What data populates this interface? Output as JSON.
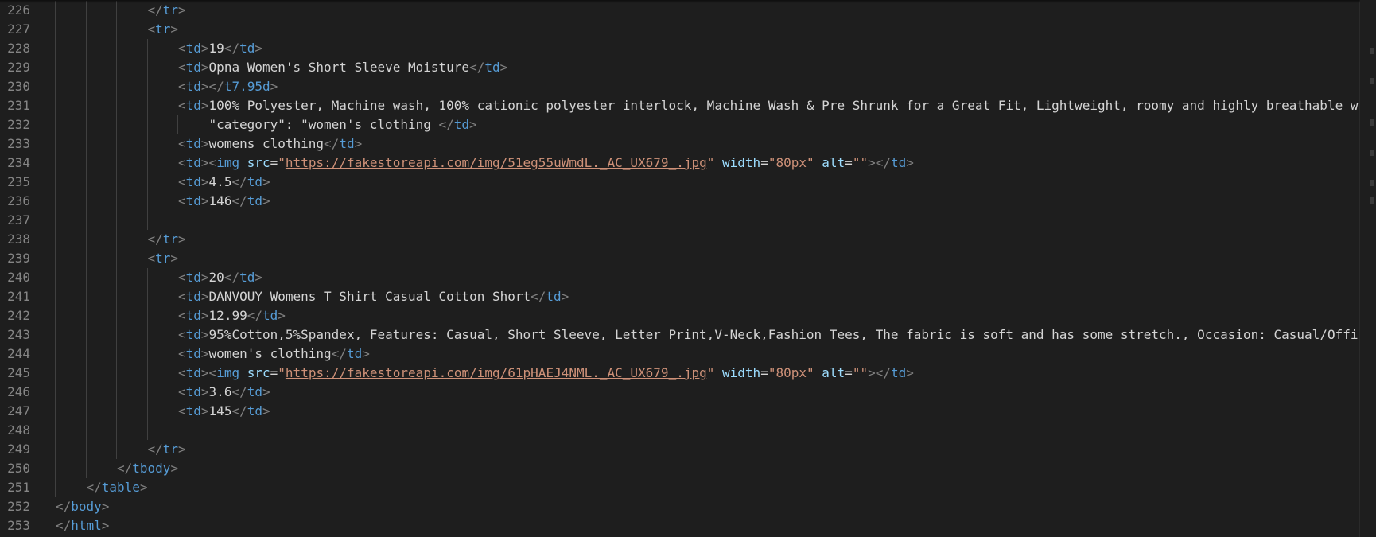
{
  "editor": {
    "colors": {
      "background": "#1e1e1e",
      "line_number": "#858585",
      "tag": "#569cd6",
      "bracket": "#808080",
      "attribute": "#9cdcfe",
      "string": "#ce9178",
      "text": "#d4d4d4"
    },
    "lines": [
      {
        "number": "226",
        "indent": 3,
        "tokens": [
          [
            "b",
            "</"
          ],
          [
            "t",
            "tr"
          ],
          [
            "b",
            ">"
          ]
        ]
      },
      {
        "number": "227",
        "indent": 3,
        "tokens": [
          [
            "b",
            "<"
          ],
          [
            "t",
            "tr"
          ],
          [
            "b",
            ">"
          ]
        ]
      },
      {
        "number": "228",
        "indent": 4,
        "tokens": [
          [
            "b",
            "<"
          ],
          [
            "t",
            "td"
          ],
          [
            "b",
            ">"
          ],
          [
            "x",
            "19"
          ],
          [
            "b",
            "</"
          ],
          [
            "t",
            "td"
          ],
          [
            "b",
            ">"
          ]
        ]
      },
      {
        "number": "229",
        "indent": 4,
        "tokens": [
          [
            "b",
            "<"
          ],
          [
            "t",
            "td"
          ],
          [
            "b",
            ">"
          ],
          [
            "x",
            "Opna Women's Short Sleeve Moisture"
          ],
          [
            "b",
            "</"
          ],
          [
            "t",
            "td"
          ],
          [
            "b",
            ">"
          ]
        ]
      },
      {
        "number": "230",
        "indent": 4,
        "tokens": [
          [
            "b",
            "<"
          ],
          [
            "t",
            "td"
          ],
          [
            "b",
            ">"
          ],
          [
            "b",
            "</"
          ],
          [
            "t",
            "t7.95d"
          ],
          [
            "b",
            ">"
          ]
        ]
      },
      {
        "number": "231",
        "indent": 4,
        "tokens": [
          [
            "b",
            "<"
          ],
          [
            "t",
            "td"
          ],
          [
            "b",
            ">"
          ],
          [
            "x",
            "100% Polyester, Machine wash, 100% cationic polyester interlock, Machine Wash & Pre Shrunk for a Great Fit, Lightweight, roomy and highly breathable w"
          ]
        ]
      },
      {
        "number": "232",
        "indent": 5,
        "tokens": [
          [
            "x",
            "\"category\": \"women's clothing "
          ],
          [
            "b",
            "</"
          ],
          [
            "t",
            "td"
          ],
          [
            "b",
            ">"
          ]
        ]
      },
      {
        "number": "233",
        "indent": 4,
        "tokens": [
          [
            "b",
            "<"
          ],
          [
            "t",
            "td"
          ],
          [
            "b",
            ">"
          ],
          [
            "x",
            "womens clothing"
          ],
          [
            "b",
            "</"
          ],
          [
            "t",
            "td"
          ],
          [
            "b",
            ">"
          ]
        ]
      },
      {
        "number": "234",
        "indent": 4,
        "tokens": [
          [
            "b",
            "<"
          ],
          [
            "t",
            "td"
          ],
          [
            "b",
            ">"
          ],
          [
            "b",
            "<"
          ],
          [
            "t",
            "img"
          ],
          [
            "x",
            " "
          ],
          [
            "a",
            "src"
          ],
          [
            "x",
            "="
          ],
          [
            "s",
            "\""
          ],
          [
            "u",
            "https://fakestoreapi.com/img/51eg55uWmdL._AC_UX679_.jpg"
          ],
          [
            "s",
            "\""
          ],
          [
            "x",
            " "
          ],
          [
            "a",
            "width"
          ],
          [
            "x",
            "="
          ],
          [
            "s",
            "\"80px\""
          ],
          [
            "x",
            " "
          ],
          [
            "a",
            "alt"
          ],
          [
            "x",
            "="
          ],
          [
            "s",
            "\"\""
          ],
          [
            "b",
            ">"
          ],
          [
            "b",
            "</"
          ],
          [
            "t",
            "td"
          ],
          [
            "b",
            ">"
          ]
        ]
      },
      {
        "number": "235",
        "indent": 4,
        "tokens": [
          [
            "b",
            "<"
          ],
          [
            "t",
            "td"
          ],
          [
            "b",
            ">"
          ],
          [
            "x",
            "4.5"
          ],
          [
            "b",
            "</"
          ],
          [
            "t",
            "td"
          ],
          [
            "b",
            ">"
          ]
        ]
      },
      {
        "number": "236",
        "indent": 4,
        "tokens": [
          [
            "b",
            "<"
          ],
          [
            "t",
            "td"
          ],
          [
            "b",
            ">"
          ],
          [
            "x",
            "146"
          ],
          [
            "b",
            "</"
          ],
          [
            "t",
            "td"
          ],
          [
            "b",
            ">"
          ]
        ]
      },
      {
        "number": "237",
        "indent": 4,
        "tokens": []
      },
      {
        "number": "238",
        "indent": 3,
        "tokens": [
          [
            "b",
            "</"
          ],
          [
            "t",
            "tr"
          ],
          [
            "b",
            ">"
          ]
        ]
      },
      {
        "number": "239",
        "indent": 3,
        "tokens": [
          [
            "b",
            "<"
          ],
          [
            "t",
            "tr"
          ],
          [
            "b",
            ">"
          ]
        ]
      },
      {
        "number": "240",
        "indent": 4,
        "tokens": [
          [
            "b",
            "<"
          ],
          [
            "t",
            "td"
          ],
          [
            "b",
            ">"
          ],
          [
            "x",
            "20"
          ],
          [
            "b",
            "</"
          ],
          [
            "t",
            "td"
          ],
          [
            "b",
            ">"
          ]
        ]
      },
      {
        "number": "241",
        "indent": 4,
        "tokens": [
          [
            "b",
            "<"
          ],
          [
            "t",
            "td"
          ],
          [
            "b",
            ">"
          ],
          [
            "x",
            "DANVOUY Womens T Shirt Casual Cotton Short"
          ],
          [
            "b",
            "</"
          ],
          [
            "t",
            "td"
          ],
          [
            "b",
            ">"
          ]
        ]
      },
      {
        "number": "242",
        "indent": 4,
        "tokens": [
          [
            "b",
            "<"
          ],
          [
            "t",
            "td"
          ],
          [
            "b",
            ">"
          ],
          [
            "x",
            "12.99"
          ],
          [
            "b",
            "</"
          ],
          [
            "t",
            "td"
          ],
          [
            "b",
            ">"
          ]
        ]
      },
      {
        "number": "243",
        "indent": 4,
        "tokens": [
          [
            "b",
            "<"
          ],
          [
            "t",
            "td"
          ],
          [
            "b",
            ">"
          ],
          [
            "x",
            "95%Cotton,5%Spandex, Features: Casual, Short Sleeve, Letter Print,V-Neck,Fashion Tees, The fabric is soft and has some stretch., Occasion: Casual/Offic"
          ]
        ]
      },
      {
        "number": "244",
        "indent": 4,
        "tokens": [
          [
            "b",
            "<"
          ],
          [
            "t",
            "td"
          ],
          [
            "b",
            ">"
          ],
          [
            "x",
            "women's clothing"
          ],
          [
            "b",
            "</"
          ],
          [
            "t",
            "td"
          ],
          [
            "b",
            ">"
          ]
        ]
      },
      {
        "number": "245",
        "indent": 4,
        "tokens": [
          [
            "b",
            "<"
          ],
          [
            "t",
            "td"
          ],
          [
            "b",
            ">"
          ],
          [
            "b",
            "<"
          ],
          [
            "t",
            "img"
          ],
          [
            "x",
            " "
          ],
          [
            "a",
            "src"
          ],
          [
            "x",
            "="
          ],
          [
            "s",
            "\""
          ],
          [
            "u",
            "https://fakestoreapi.com/img/61pHAEJ4NML._AC_UX679_.jpg"
          ],
          [
            "s",
            "\""
          ],
          [
            "x",
            " "
          ],
          [
            "a",
            "width"
          ],
          [
            "x",
            "="
          ],
          [
            "s",
            "\"80px\""
          ],
          [
            "x",
            " "
          ],
          [
            "a",
            "alt"
          ],
          [
            "x",
            "="
          ],
          [
            "s",
            "\"\""
          ],
          [
            "b",
            ">"
          ],
          [
            "b",
            "</"
          ],
          [
            "t",
            "td"
          ],
          [
            "b",
            ">"
          ]
        ]
      },
      {
        "number": "246",
        "indent": 4,
        "tokens": [
          [
            "b",
            "<"
          ],
          [
            "t",
            "td"
          ],
          [
            "b",
            ">"
          ],
          [
            "x",
            "3.6"
          ],
          [
            "b",
            "</"
          ],
          [
            "t",
            "td"
          ],
          [
            "b",
            ">"
          ]
        ]
      },
      {
        "number": "247",
        "indent": 4,
        "tokens": [
          [
            "b",
            "<"
          ],
          [
            "t",
            "td"
          ],
          [
            "b",
            ">"
          ],
          [
            "x",
            "145"
          ],
          [
            "b",
            "</"
          ],
          [
            "t",
            "td"
          ],
          [
            "b",
            ">"
          ]
        ]
      },
      {
        "number": "248",
        "indent": 4,
        "tokens": []
      },
      {
        "number": "249",
        "indent": 3,
        "tokens": [
          [
            "b",
            "</"
          ],
          [
            "t",
            "tr"
          ],
          [
            "b",
            ">"
          ]
        ]
      },
      {
        "number": "250",
        "indent": 2,
        "tokens": [
          [
            "b",
            "</"
          ],
          [
            "t",
            "tbody"
          ],
          [
            "b",
            ">"
          ]
        ]
      },
      {
        "number": "251",
        "indent": 1,
        "tokens": [
          [
            "b",
            "</"
          ],
          [
            "t",
            "table"
          ],
          [
            "b",
            ">"
          ]
        ]
      },
      {
        "number": "252",
        "indent": 0,
        "tokens": [
          [
            "b",
            "</"
          ],
          [
            "t",
            "body"
          ],
          [
            "b",
            ">"
          ]
        ]
      },
      {
        "number": "253",
        "indent": 0,
        "tokens": [
          [
            "b",
            "</"
          ],
          [
            "t",
            "html"
          ],
          [
            "b",
            ">"
          ]
        ]
      }
    ]
  }
}
